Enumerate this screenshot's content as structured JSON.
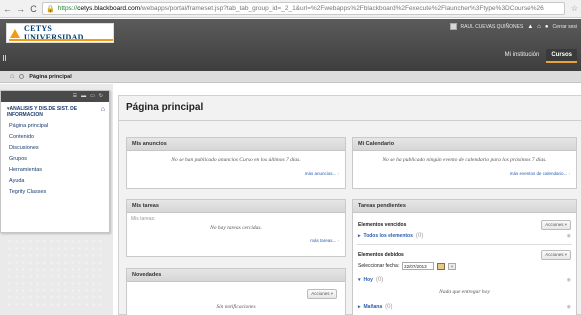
{
  "browser": {
    "back": "←",
    "forward": "→",
    "reload": "C",
    "url_protocol": "https://",
    "url_host": "cetys.blackboard.com",
    "url_path": "/webapps/portal/frameset.jsp?tab_tab_group_id=_2_1&url=%2Fwebapps%2Fblackboard%2Fexecute%2Flauncher%3Ftype%3DCourse%26"
  },
  "header": {
    "logo_text": "CETYS UNIVERSIDAD",
    "user_name": "RAUL CUEVAS QUIÑONES",
    "logout": "Cerrar sesi",
    "tabs": [
      "Mi institución",
      "Cursos"
    ],
    "active_tab": "Cursos"
  },
  "breadcrumb": {
    "page": "Página principal"
  },
  "sidebar": {
    "course_title": "ANALISIS Y DIS.DE SIST. DE INFORMACION",
    "items": [
      "Página principal",
      "Contenido",
      "Discusiones",
      "Grupos",
      "Herramientas",
      "Ayuda",
      "Tegrity Classes"
    ]
  },
  "main": {
    "title": "Página principal",
    "anuncios": {
      "title": "Mis anuncios",
      "empty": "No se han publicado anuncios Curso en los últimos 7 días.",
      "more": "más anuncios..."
    },
    "calendario": {
      "title": "Mi Calendario",
      "empty": "No se ha publicado ningún evento de calendario para los próximos 7 días.",
      "more": "más eventos de calendario..."
    },
    "tareas": {
      "title": "Mis tareas",
      "label": "Mis tareas:",
      "empty": "No hay tareas cercidas.",
      "more": "más tareas..."
    },
    "pendientes": {
      "title": "Tareas pendientes",
      "vencidos_label": "Elementos vencidos",
      "acciones": "Acciones",
      "todos": "Todos los elementos",
      "todos_count": "(0)",
      "debidos_label": "Elementos debidos",
      "fecha_label": "Seleccionar fecha:",
      "fecha_value": "22/07/2013",
      "hoy": "Hoy",
      "hoy_count": "(0)",
      "hoy_empty": "Nada que entregar hoy",
      "manana": "Mañana",
      "manana_count": "(0)"
    },
    "novedades": {
      "title": "Novedades",
      "acciones": "Acciones",
      "empty": "Sin notificaciones"
    }
  }
}
